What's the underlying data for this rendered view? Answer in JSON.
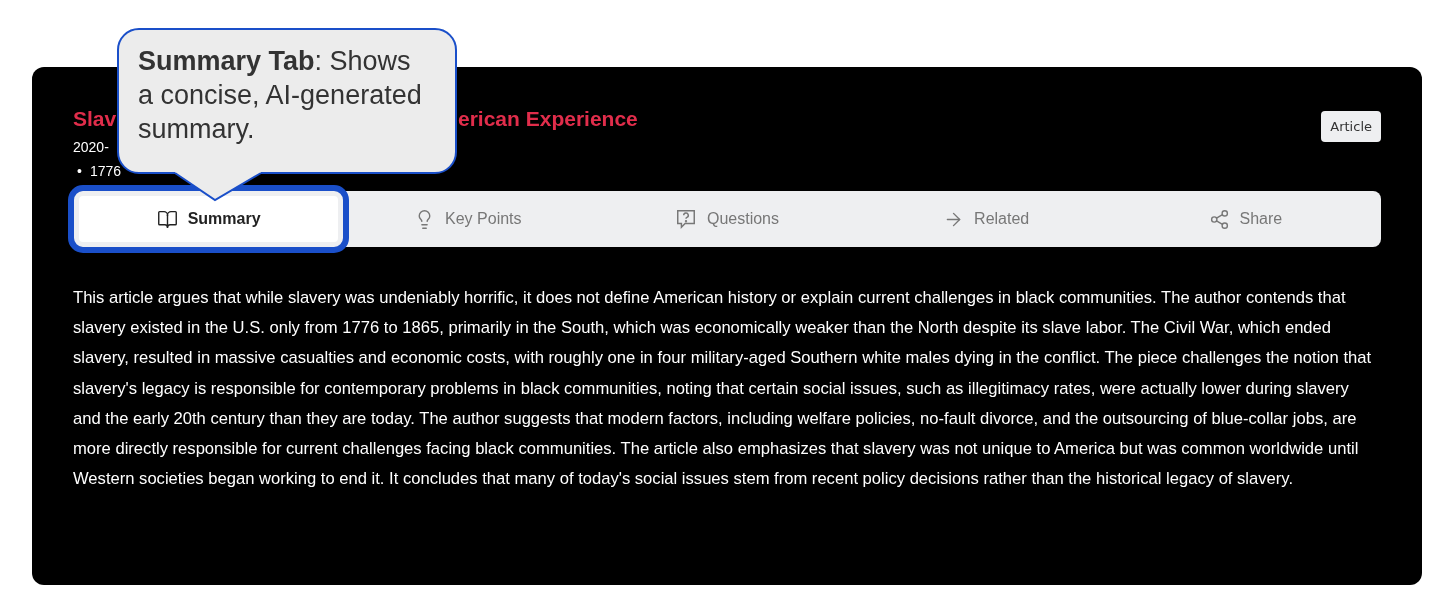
{
  "callout": {
    "text": "**Summary Tab**: Shows a concise, AI-generated summary."
  },
  "title": {
    "visible_start": "Slav",
    "visible_end": "erican Experience"
  },
  "date": "2020-",
  "tags": [
    {
      "marker": "•",
      "text": "1776"
    }
  ],
  "badge": "Article",
  "tabs": [
    {
      "kind": "book",
      "label": "Summary",
      "selected": true
    },
    {
      "kind": "bulb",
      "label": "Key Points",
      "selected": false
    },
    {
      "kind": "question",
      "label": "Questions",
      "selected": false
    },
    {
      "kind": "arrow",
      "label": "Related",
      "selected": false
    },
    {
      "kind": "share",
      "label": "Share",
      "selected": false
    }
  ],
  "summary": "This article argues that while slavery was undeniably horrific, it does not define American history or explain current challenges in black communities. The author contends that slavery existed in the U.S. only from 1776 to 1865, primarily in the South, which was economically weaker than the North despite its slave labor. The Civil War, which ended slavery, resulted in massive casualties and economic costs, with roughly one in four military-aged Southern white males dying in the conflict. The piece challenges the notion that slavery's legacy is responsible for contemporary problems in black communities, noting that certain social issues, such as illegitimacy rates, were actually lower during slavery and the early 20th century than they are today. The author suggests that modern factors, including welfare policies, no-fault divorce, and the outsourcing of blue-collar jobs, are more directly responsible for current challenges facing black communities. The article also emphasizes that slavery was not unique to America but was common worldwide until Western societies began working to end it. It concludes that many of today's social issues stem from recent policy decisions rather than the historical legacy of slavery."
}
